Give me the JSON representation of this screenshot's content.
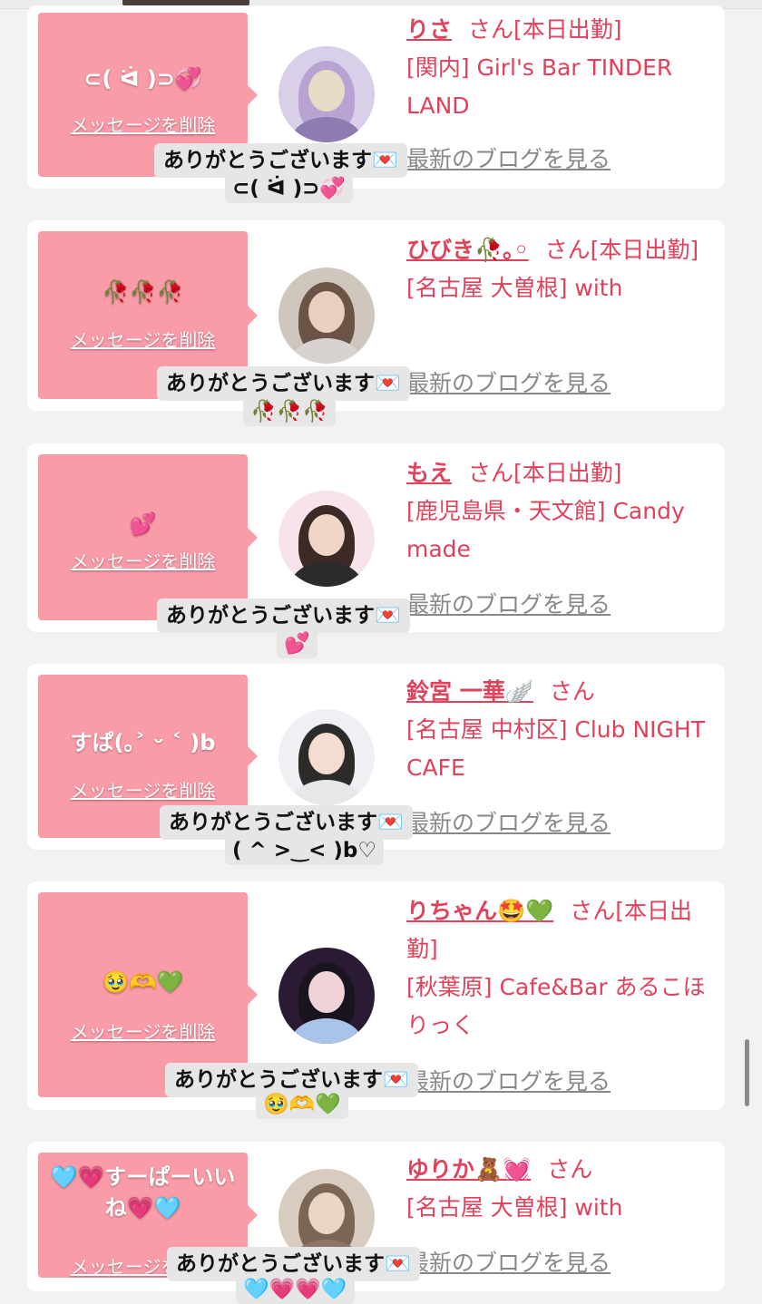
{
  "delete_label": "メッセージを削除",
  "san_label": "さん",
  "blog_label": "最新のブログを見る",
  "reply_text": "ありがとうございます💌",
  "today_badge": "[本日出勤]",
  "entries": [
    {
      "message": "⊂( ᐛ )⊃💞",
      "name": "りさ",
      "badge": "[本日出勤]",
      "shop": "[関内] Girl's Bar TINDER LAND",
      "reply_emoji": "⊂( ᐛ )⊃💞"
    },
    {
      "message": "🥀🥀🥀",
      "name": "ひびき🥀｡◦",
      "badge": "[本日出勤]",
      "shop": "[名古屋 大曽根] with",
      "reply_emoji": "🥀🥀🥀"
    },
    {
      "message": "💕",
      "name": "もえ",
      "badge": "[本日出勤]",
      "shop": "[鹿児島県・天文館] Candy made",
      "reply_emoji": "💕"
    },
    {
      "message": "すぱ(｡˃ ᵕ ˂ )b",
      "name": "鈴宮 一華🪽",
      "badge": "",
      "shop": "[名古屋 中村区] Club NIGHT CAFE",
      "reply_emoji": "( ^ >‿< )b♡"
    },
    {
      "message": "🥹🫶💚",
      "name": "りちゃん🤩💚",
      "badge": "[本日出勤]",
      "shop": "[秋葉原] Cafe&Bar あるこほりっく",
      "reply_emoji": "🥹🫶💚"
    },
    {
      "message": "🩵💗すーぱーいいね💗🩵",
      "name": "ゆりか🧸💓",
      "badge": "",
      "shop": "[名古屋 大曽根] with",
      "reply_emoji": "🩵💗💗🩵"
    }
  ],
  "colors": {
    "bubble": "#fa9ba8",
    "accent": "#e0415b",
    "link_gray": "#888888",
    "background": "#f2f2f2"
  }
}
